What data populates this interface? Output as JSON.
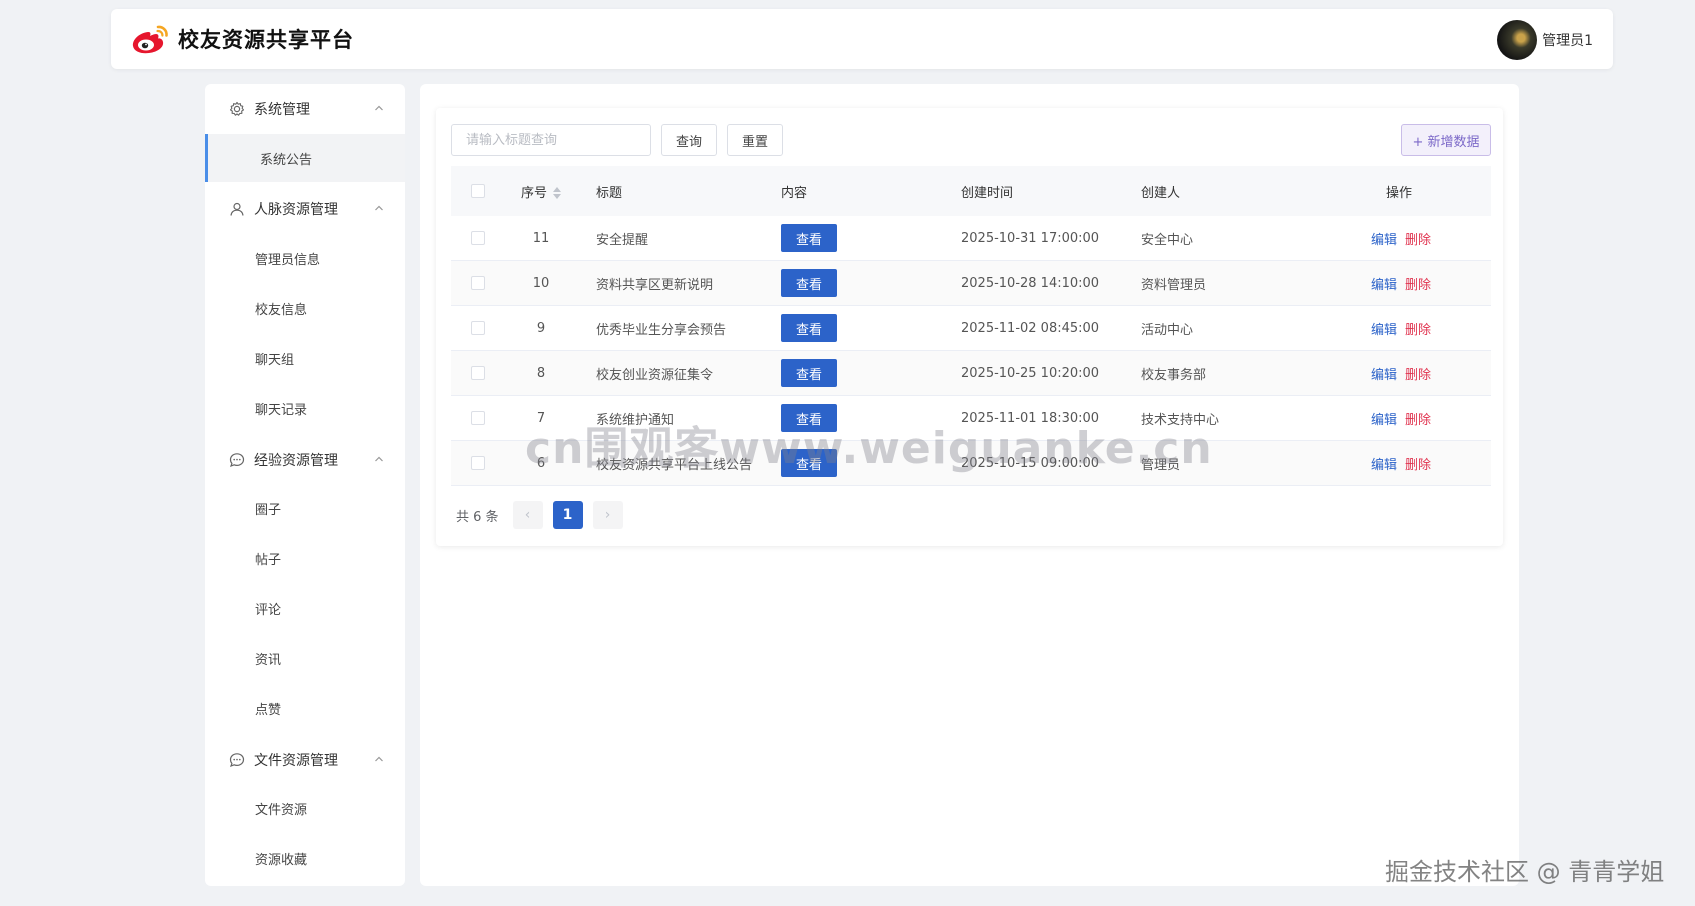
{
  "header": {
    "title": "校友资源共享平台",
    "user_name": "管理员1"
  },
  "sidebar": {
    "groups": [
      {
        "label": "系统管理",
        "icon": "gear-icon",
        "items": [
          "系统公告"
        ]
      },
      {
        "label": "人脉资源管理",
        "icon": "user-icon",
        "items": [
          "管理员信息",
          "校友信息",
          "聊天组",
          "聊天记录"
        ]
      },
      {
        "label": "经验资源管理",
        "icon": "chat-icon",
        "items": [
          "圈子",
          "帖子",
          "评论",
          "资讯",
          "点赞"
        ]
      },
      {
        "label": "文件资源管理",
        "icon": "chat-icon",
        "items": [
          "文件资源",
          "资源收藏"
        ]
      }
    ],
    "active_item": "系统公告"
  },
  "toolbar": {
    "search_placeholder": "请输入标题查询",
    "query_label": "查询",
    "reset_label": "重置",
    "add_label": "+ 新增数据"
  },
  "table": {
    "headers": {
      "id": "序号",
      "title": "标题",
      "content": "内容",
      "time": "创建时间",
      "creator": "创建人",
      "ops": "操作"
    },
    "view_label": "查看",
    "edit_label": "编辑",
    "delete_label": "删除",
    "rows": [
      {
        "id": "11",
        "title": "安全提醒",
        "time": "2025-10-31 17:00:00",
        "creator": "安全中心"
      },
      {
        "id": "10",
        "title": "资料共享区更新说明",
        "time": "2025-10-28 14:10:00",
        "creator": "资料管理员"
      },
      {
        "id": "9",
        "title": "优秀毕业生分享会预告",
        "time": "2025-11-02 08:45:00",
        "creator": "活动中心"
      },
      {
        "id": "8",
        "title": "校友创业资源征集令",
        "time": "2025-10-25 10:20:00",
        "creator": "校友事务部"
      },
      {
        "id": "7",
        "title": "系统维护通知",
        "time": "2025-11-01 18:30:00",
        "creator": "技术支持中心"
      },
      {
        "id": "6",
        "title": "校友资源共享平台上线公告",
        "time": "2025-10-15 09:00:00",
        "creator": "管理员"
      }
    ]
  },
  "pagination": {
    "total_label": "共 6 条",
    "current_page": "1"
  },
  "watermarks": {
    "center": "cn围观客www.weiguanke.cn",
    "corner": "掘金技术社区 @ 青青学姐"
  }
}
